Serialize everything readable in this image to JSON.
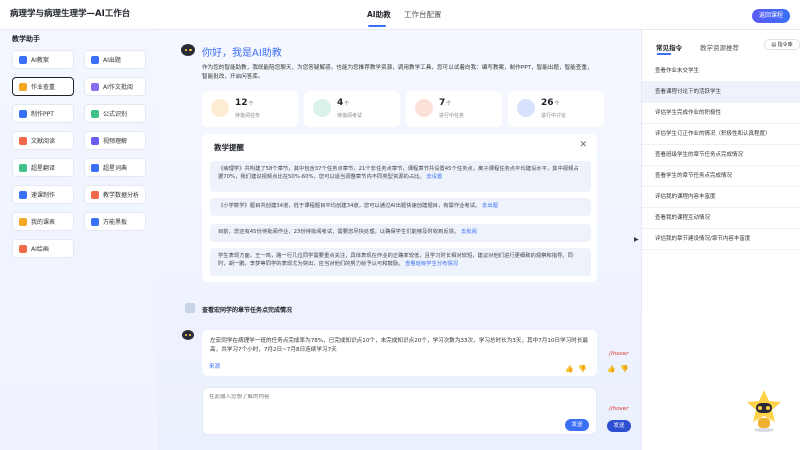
{
  "header": {
    "title": "病理学与病理生理学—AI工作台",
    "tabs": [
      "AI助教",
      "工作台配置"
    ],
    "return_button": "返回课程"
  },
  "sidebar": {
    "title": "教学助手",
    "tools": [
      {
        "label": "AI教案",
        "color": "#3a6ff7"
      },
      {
        "label": "AI出题",
        "color": "#3a6ff7"
      },
      {
        "label": "作业查重",
        "color": "#f5a623"
      },
      {
        "label": "AI作文批阅",
        "color": "#8a6cf0"
      },
      {
        "label": "制作PPT",
        "color": "#3a6ff7"
      },
      {
        "label": "公式识别",
        "color": "#3fc28a"
      },
      {
        "label": "文献阅读",
        "color": "#f06a4a"
      },
      {
        "label": "视频理解",
        "color": "#6b5bf0"
      },
      {
        "label": "超星翻译",
        "color": "#3fc28a"
      },
      {
        "label": "超星词典",
        "color": "#3a6ff7"
      },
      {
        "label": "速课制作",
        "color": "#3a6ff7"
      },
      {
        "label": "教学数据分析",
        "color": "#f06a4a"
      },
      {
        "label": "我的课表",
        "color": "#f5a623"
      },
      {
        "label": "万能黑板",
        "color": "#3a6ff7"
      },
      {
        "label": "AI绘画",
        "color": "#f06a4a"
      }
    ]
  },
  "main": {
    "greeting": "你好，我是AI助教",
    "intro": "作为您的智能助教，我既能陪您聊天，为您答疑解惑，也能为您推荐教学资源，调用教学工具，您可以试着向我：编写教案，制作PPT，智能出题，智能查重，智能批改，开启问答库。",
    "stats": [
      {
        "num": "12",
        "unit": "个",
        "label": "待批阅任务",
        "color": "#f5a623"
      },
      {
        "num": "4",
        "unit": "个",
        "label": "待批阅考试",
        "color": "#3fc28a"
      },
      {
        "num": "7",
        "unit": "个",
        "label": "进行中任务",
        "color": "#f06a4a"
      },
      {
        "num": "26",
        "unit": "个",
        "label": "进行中讨论",
        "color": "#3a6ff7"
      }
    ],
    "reminder": {
      "title": "教学提醒",
      "close": "✕",
      "items": [
        {
          "text": "《病理学》共构建了58个章节，其中包含37个任务点章节，21个非任务点章节，课程章节共设置45个任务点，离子课程任务点平均建设水平，其中视频占据70%，我们建议视频点比在50%-60%，您可以适当调整章节内不同类型资源的占比。",
          "link": "去设置"
        },
        {
          "text": "《小学数学》题目共创建34道，低于课程题目平均创建34道，您可以通过AI出题快速创建题目，有需作业考试。",
          "link": "去出题"
        },
        {
          "text": "目前，您还有45份待批阅作业，23份待批阅考试，需要您尽快处理，以确保学生们能够及时收到反馈。",
          "link": "去批阅"
        },
        {
          "text": "学生表现方面，王一鸣，路一行几位同学需要重点关注，具体表现在作业的正确率较低，且学习时长相对较短，建议对他们进行更细致的观察和指导。同时，胡一鹏，李梦等同学的表现尤为突出，应当对他们的努力给予认可和鼓励。",
          "link": "查看班级学生分布情况"
        }
      ]
    },
    "question": "查看宏同学的章节任务点完成情况",
    "answer": "左宏同学在病理学一班的任务点完成率为78%，已完成知识点10个，未完成知识点20个，学习次数为33次，学习总时长为3天，其中7月10日学习时长最高，共学习7个小时，7月2日~7月8日连续学习7天",
    "source": "来源",
    "hover_note": "//hover",
    "input_placeholder": "在此输入您想了解的内容",
    "send": "发送"
  },
  "right_panel": {
    "tabs": [
      "常见指令",
      "教学资源推荐"
    ],
    "command_library": "指令库",
    "commands": [
      "查看作业未交学生",
      "查看课程讨论下的活跃学生",
      "评估学生完成作业的积极性",
      "评估学生订正作业的情况（积极性和认真程度）",
      "查看班级学生的章节任务点完成情况",
      "查看学生的章节任务点完成情况",
      "评估我的课程内容丰富度",
      "查看我的课程互动情况",
      "评估我的章节建设情况/章节内容丰富度"
    ]
  }
}
